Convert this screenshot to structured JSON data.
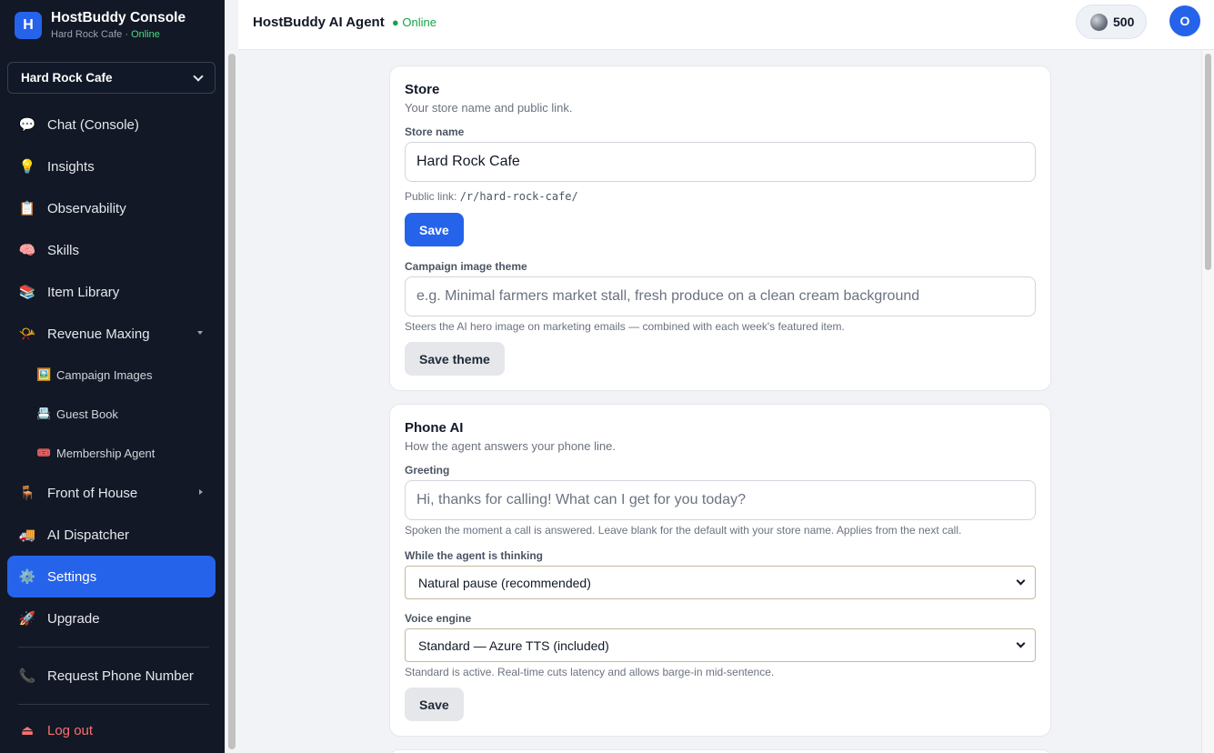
{
  "app": {
    "logo_letter": "H",
    "name": "HostBuddy Console",
    "store": "Hard Rock Cafe",
    "separator": "·",
    "status": "Online"
  },
  "sidebar": {
    "store_select": "Hard Rock Cafe",
    "items": [
      {
        "label": "Chat (Console)",
        "icon": "💬"
      },
      {
        "label": "Insights",
        "icon": "💡"
      },
      {
        "label": "Observability",
        "icon": "📋"
      },
      {
        "label": "Skills",
        "icon": "🧠"
      },
      {
        "label": "Item Library",
        "icon": "📚"
      },
      {
        "label": "Revenue Maxing",
        "icon": "📯"
      },
      {
        "label": "Front of House",
        "icon": "🪑"
      },
      {
        "label": "AI Dispatcher",
        "icon": "🚚"
      },
      {
        "label": "Settings",
        "icon": "⚙️"
      },
      {
        "label": "Upgrade",
        "icon": "🚀"
      },
      {
        "label": "Request Phone Number",
        "icon": "📞"
      },
      {
        "label": "Log out",
        "icon": "⏏"
      }
    ],
    "sub_items": [
      {
        "label": "Campaign Images",
        "icon": "🖼️"
      },
      {
        "label": "Guest Book",
        "icon": "📇"
      },
      {
        "label": "Membership Agent",
        "icon": "🎟️"
      }
    ]
  },
  "header": {
    "title": "HostBuddy AI Agent",
    "status": "● Online",
    "credits": "500",
    "avatar_letter": "O"
  },
  "store_card": {
    "title": "Store",
    "subtitle": "Your store name and public link.",
    "name_label": "Store name",
    "name_value": "Hard Rock Cafe",
    "public_link_label": "Public link:",
    "public_link": "/r/hard-rock-cafe/",
    "save_label": "Save",
    "theme_label": "Campaign image theme",
    "theme_placeholder": "e.g. Minimal farmers market stall, fresh produce on a clean cream background",
    "theme_hint": "Steers the AI hero image on marketing emails — combined with each week's featured item.",
    "save_theme_label": "Save theme"
  },
  "phone_card": {
    "title": "Phone AI",
    "subtitle": "How the agent answers your phone line.",
    "greeting_label": "Greeting",
    "greeting_placeholder": "Hi, thanks for calling! What can I get for you today?",
    "greeting_hint": "Spoken the moment a call is answered. Leave blank for the default with your store name. Applies from the next call.",
    "thinking_label": "While the agent is thinking",
    "thinking_value": "Natural pause (recommended)",
    "voice_label": "Voice engine",
    "voice_value": "Standard — Azure TTS (included)",
    "voice_hint": "Standard is active. Real-time cuts latency and allows barge-in mid-sentence.",
    "save_label": "Save"
  },
  "colors": {
    "accent": "#2563eb",
    "sidebar_bg": "#121826",
    "online": "#16a34a",
    "logout": "#f87171"
  }
}
